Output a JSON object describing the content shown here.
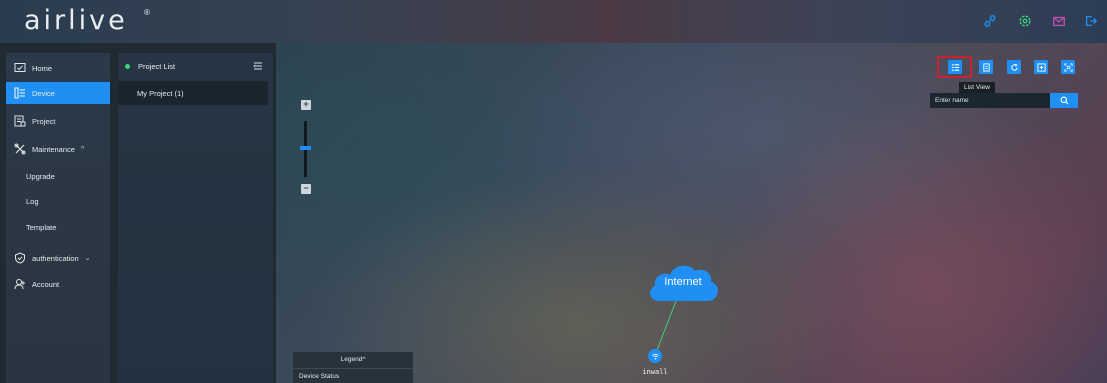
{
  "header": {
    "logo_text": "airlive",
    "logo_reg": "®",
    "icons": [
      "link-icon",
      "settings-icon",
      "mail-icon",
      "logout-icon"
    ],
    "accent": "#1f8ff3",
    "icon_colors": {
      "link": "#1f8ff3",
      "settings": "#3ed07b",
      "mail": "#c34fb0",
      "logout": "#1f8ff3"
    }
  },
  "sidebar": {
    "items": [
      {
        "label": "Home",
        "icon": "home-icon"
      },
      {
        "label": "Device",
        "icon": "device-list-icon",
        "active": true
      },
      {
        "label": "Project",
        "icon": "project-icon"
      },
      {
        "label": "Maintenance",
        "icon": "tools-icon",
        "chevron": "^"
      },
      {
        "label": "Upgrade"
      },
      {
        "label": "Log"
      },
      {
        "label": "Template"
      },
      {
        "label": "authentication",
        "icon": "shield-icon",
        "chevron": "⌄"
      },
      {
        "label": "Account",
        "icon": "user-icon"
      }
    ]
  },
  "project_panel": {
    "title": "Project List",
    "status_color": "#3ed07b",
    "items": [
      {
        "label": "My Project (1)"
      }
    ]
  },
  "canvas": {
    "zoom_in": "+",
    "zoom_out": "−",
    "zoom_level": 0.45,
    "toolbar": [
      "list-view-icon",
      "document-icon",
      "refresh-icon",
      "add-icon",
      "fit-screen-icon"
    ],
    "tooltip": "List View",
    "search": {
      "placeholder": "Enter name"
    },
    "cloud_label": "Internet",
    "device_label": "inwall",
    "legend": {
      "title": "Legend^",
      "status": "Device Status"
    }
  }
}
